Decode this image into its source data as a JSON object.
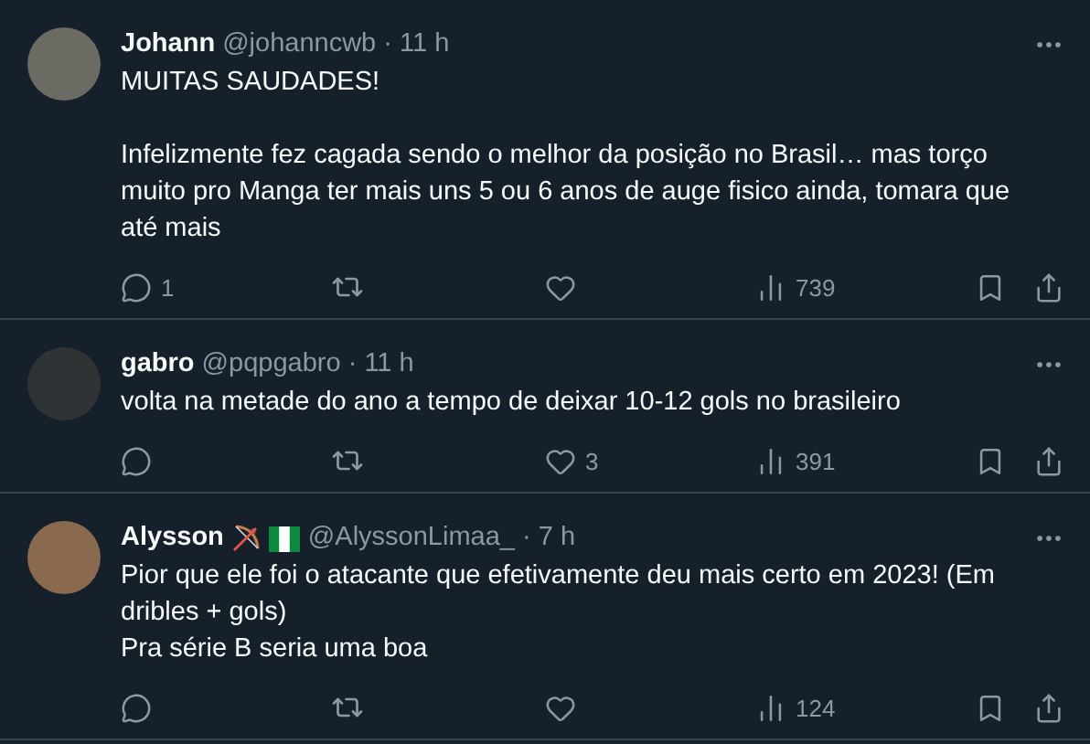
{
  "tweets": [
    {
      "name": "Johann",
      "handle": "@johanncwb",
      "separator": "·",
      "time": "11 h",
      "body": "MUITAS SAUDADES!\n\nInfelizmente fez cagada sendo o melhor da posição no Brasil… mas torço muito pro Manga ter mais uns 5 ou 6 anos de auge fisico ainda, tomara que até mais",
      "replies": "1",
      "views": "739"
    },
    {
      "name": "gabro",
      "handle": "@pqpgabro",
      "separator": "·",
      "time": "11 h",
      "body": "volta na metade do ano a tempo de deixar 10-12 gols no brasileiro",
      "likes": "3",
      "views": "391"
    },
    {
      "name": "Alysson",
      "badges": [
        {
          "kind": "bow"
        },
        {
          "kind": "flag"
        }
      ],
      "handle": "@AlyssonLimaa_",
      "separator": "·",
      "time": "7 h",
      "body": "Pior que ele foi o atacante que efetivamente deu mais certo em 2023! (Em dribles + gols)\nPra série B seria uma boa",
      "views": "124"
    }
  ]
}
